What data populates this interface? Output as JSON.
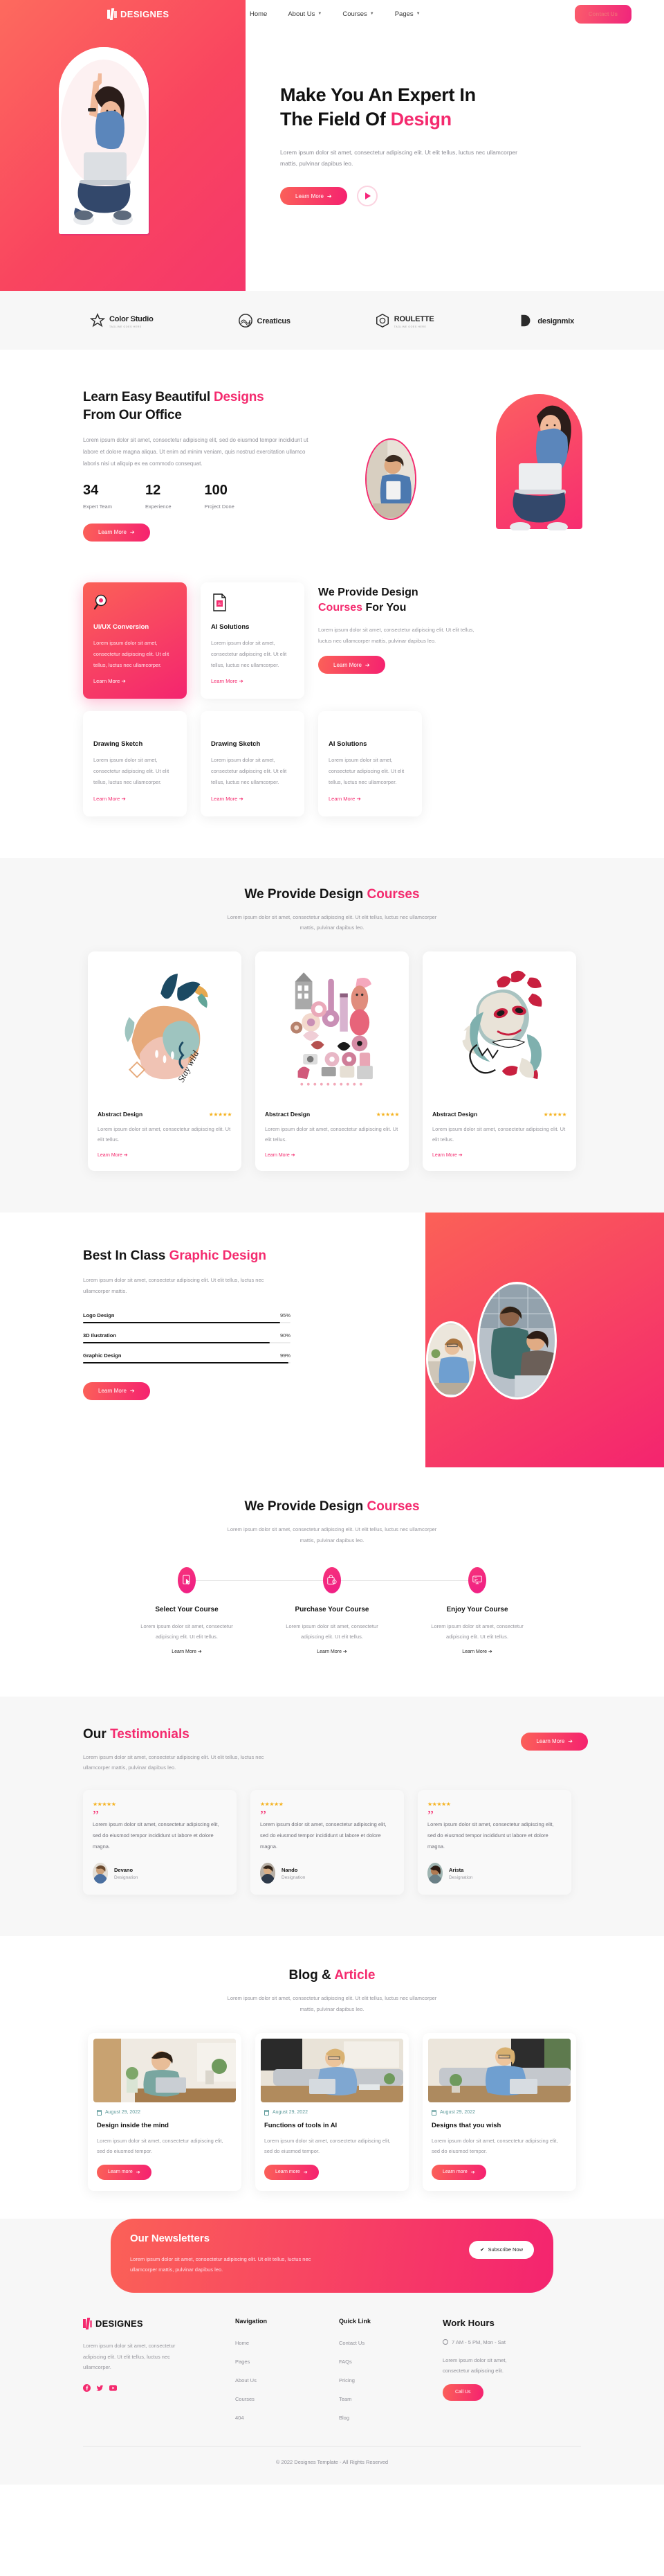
{
  "brand": {
    "name": "DESIGNES"
  },
  "nav": {
    "links": [
      {
        "label": "Home",
        "caret": false
      },
      {
        "label": "About Us",
        "caret": true
      },
      {
        "label": "Courses",
        "caret": true
      },
      {
        "label": "Pages",
        "caret": true
      }
    ],
    "cta": "Contact Us"
  },
  "hero": {
    "title_line1": "Make You An Expert In",
    "title_line2_plain": "The Field Of ",
    "title_line2_hl": "Design",
    "subtitle": "Lorem ipsum dolor sit amet, consectetur adipiscing elit. Ut elit tellus, luctus nec ullamcorper mattis, pulvinar dapibus leo.",
    "cta": "Learn More",
    "play": "play-button"
  },
  "partners": [
    {
      "name": "Color Studio",
      "tagline": "TAGLINE GOES HERE",
      "icon": "star-icon"
    },
    {
      "name": "Creaticus",
      "tagline": "",
      "icon": "wave-circle-icon"
    },
    {
      "name": "ROULETTE",
      "tagline": "TAGLINE GOES HERE",
      "icon": "hexagon-icon"
    },
    {
      "name": "designmix",
      "tagline": "",
      "icon": "d-mark-icon"
    }
  ],
  "about": {
    "title_l1_plain": "Learn Easy Beautiful ",
    "title_l1_hl": "Designs",
    "title_l2": "From Our Office",
    "paragraph": "Lorem ipsum dolor sit amet, consectetur adipiscing elit, sed do eiusmod tempor incididunt ut labore et dolore magna aliqua. Ut enim ad minim veniam, quis nostrud exercitation ullamco laboris nisi ut aliquip ex ea commodo consequat.",
    "stats": [
      {
        "value": "34",
        "label": "Expert Team"
      },
      {
        "value": "12",
        "label": "Experience"
      },
      {
        "value": "100",
        "label": "Project Done"
      }
    ],
    "cta": "Learn More"
  },
  "features": {
    "cards": [
      {
        "title": "UI/UX Conversion",
        "text": "Lorem ipsum dolor sit amet, consectetur adipiscing elit. Ut elit tellus, luctus nec ullamcorper.",
        "link": "Learn More",
        "icon": "magnifier-icon",
        "active": true
      },
      {
        "title": "AI Solutions",
        "text": "Lorem ipsum dolor sit amet, consectetur adipiscing elit. Ut elit tellus, luctus nec ullamcorper.",
        "link": "Learn More",
        "icon": "ai-file-icon",
        "active": false
      }
    ],
    "side": {
      "title_l1": "We Provide Design",
      "title_l2_hl": "Courses",
      "title_l2_plain": " For You",
      "text": "Lorem ipsum dolor sit amet, consectetur adipiscing elit. Ut elit tellus, luctus nec ullamcorper mattis, pulvinar dapibus leo.",
      "cta": "Learn More"
    },
    "row2": [
      {
        "title": "Drawing Sketch",
        "text": "Lorem ipsum dolor sit amet, consectetur adipiscing elit. Ut elit tellus, luctus nec ullamcorper.",
        "link": "Learn More"
      },
      {
        "title": "Drawing Sketch",
        "text": "Lorem ipsum dolor sit amet, consectetur adipiscing elit. Ut elit tellus, luctus nec ullamcorper.",
        "link": "Learn More"
      },
      {
        "title": "AI Solutions",
        "text": "Lorem ipsum dolor sit amet, consectetur adipiscing elit. Ut elit tellus, luctus nec ullamcorper.",
        "link": "Learn More"
      }
    ]
  },
  "courses": {
    "title_plain": "We Provide Design ",
    "title_hl": "Courses",
    "subtitle": "Lorem ipsum dolor sit amet, consectetur adipiscing elit. Ut elit tellus, luctus nec ullamcorper mattis, pulvinar dapibus leo.",
    "cards": [
      {
        "title": "Abstract Design",
        "stars": "★★★★★",
        "text": "Lorem ipsum dolor sit amet, consectetur adipiscing elit. Ut elit tellus.",
        "link": "Learn More",
        "art": "stay-wild-illustration"
      },
      {
        "title": "Abstract Design",
        "stars": "★★★★★",
        "text": "Lorem ipsum dolor sit amet, consectetur adipiscing elit. Ut elit tellus.",
        "link": "Learn More",
        "art": "collage-illustration"
      },
      {
        "title": "Abstract Design",
        "stars": "★★★★★",
        "text": "Lorem ipsum dolor sit amet, consectetur adipiscing elit. Ut elit tellus.",
        "link": "Learn More",
        "art": "mask-illustration"
      }
    ]
  },
  "skills": {
    "title_plain": "Best In Class ",
    "title_hl": "Graphic Design",
    "text": "Lorem ipsum dolor sit amet, consectetur adipiscing elit. Ut elit tellus, luctus nec ullamcorper mattis.",
    "cta": "Learn More"
  },
  "steps": {
    "title_plain": "We Provide Design ",
    "title_hl": "Courses",
    "subtitle": "Lorem ipsum dolor sit amet, consectetur adipiscing elit. Ut elit tellus, luctus nec ullamcorper mattis, pulvinar dapibus leo.",
    "items": [
      {
        "title": "Select Your Course",
        "text": "Lorem ipsum dolor sit amet, consectetur adipiscing elit. Ut elit tellus.",
        "link": "Learn More",
        "icon": "cursor-select-icon"
      },
      {
        "title": "Purchase Your Course",
        "text": "Lorem ipsum dolor sit amet, consectetur adipiscing elit. Ut elit tellus.",
        "link": "Learn More",
        "icon": "purchase-card-icon"
      },
      {
        "title": "Enjoy Your Course",
        "text": "Lorem ipsum dolor sit amet, consectetur adipiscing elit. Ut elit tellus.",
        "link": "Learn More",
        "icon": "monitor-learn-icon"
      }
    ]
  },
  "testimonials": {
    "title_plain": "Our ",
    "title_hl": "Testimonials",
    "text": "Lorem ipsum dolor sit amet, consectetur adipiscing elit. Ut elit tellus, luctus nec ullamcorper mattis, pulvinar dapibus leo.",
    "cta": "Learn More",
    "items": [
      {
        "stars": "★★★★★",
        "quote": "Lorem ipsum dolor sit amet, consectetur adipiscing elit, sed do eiusmod tempor incididunt ut labore et dolore magna.",
        "name": "Devano",
        "designation": "Designation"
      },
      {
        "stars": "★★★★★",
        "quote": "Lorem ipsum dolor sit amet, consectetur adipiscing elit, sed do eiusmod tempor incididunt ut labore et dolore magna.",
        "name": "Nando",
        "designation": "Designation"
      },
      {
        "stars": "★★★★★",
        "quote": "Lorem ipsum dolor sit amet, consectetur adipiscing elit, sed do eiusmod tempor incididunt ut labore et dolore magna.",
        "name": "Arista",
        "designation": "Designation"
      }
    ]
  },
  "blog": {
    "title_plain": "Blog & ",
    "title_hl": "Article",
    "subtitle": "Lorem ipsum dolor sit amet, consectetur adipiscing elit. Ut elit tellus, luctus nec ullamcorper mattis, pulvinar dapibus leo.",
    "posts": [
      {
        "date": "August 29, 2022",
        "title": "Design inside the mind",
        "text": "Lorem ipsum dolor sit amet, consectetur adipiscing elit, sed do eiusmod tempor.",
        "cta": "Learn more"
      },
      {
        "date": "August 29, 2022",
        "title": "Functions of tools in AI",
        "text": "Lorem ipsum dolor sit amet, consectetur adipiscing elit, sed do eiusmod tempor.",
        "cta": "Learn more"
      },
      {
        "date": "August 29, 2022",
        "title": "Designs that you wish",
        "text": "Lorem ipsum dolor sit amet, consectetur adipiscing elit, sed do eiusmod tempor.",
        "cta": "Learn more"
      }
    ]
  },
  "newsletter": {
    "title": "Our Newsletters",
    "text": "Lorem ipsum dolor sit amet, consectetur adipiscing elit. Ut elit tellus, luctus nec ullamcorper mattis, pulvinar dapibus leo.",
    "cta": "Subscribe Now"
  },
  "footer": {
    "about": "Lorem ipsum dolor sit amet, consectetur adipiscing elit. Ut elit tellus, luctus nec ullamcorper.",
    "socials": [
      "facebook-icon",
      "twitter-icon",
      "youtube-icon"
    ],
    "navigation": {
      "heading": "Navigation",
      "items": [
        "Home",
        "Pages",
        "About Us",
        "Courses",
        "404"
      ]
    },
    "quicklink": {
      "heading": "Quick Link",
      "items": [
        "Contact Us",
        "FAQs",
        "Pricing",
        "Team",
        "Blog"
      ]
    },
    "workhours": {
      "heading": "Work Hours",
      "hours": "7 AM - 5 PM, Mon - Sat",
      "text": "Lorem ipsum dolor sit amet, consectetur adipiscing elit.",
      "cta": "Call Us"
    },
    "copyright": "© 2022 Designes Template - All Rights Reserved"
  },
  "colors": {
    "accent": "#f42a6e",
    "gradient_start": "#fb6157",
    "gradient_end": "#f4246f",
    "star": "#f5b21f"
  },
  "chart_data": {
    "type": "bar",
    "title": "Best In Class Graphic Design",
    "categories": [
      "Logo Design",
      "3D Ilustration",
      "Graphic Design"
    ],
    "values": [
      95,
      90,
      99
    ],
    "labels": [
      "95%",
      "90%",
      "99%"
    ],
    "xlabel": "",
    "ylabel": "",
    "ylim": [
      0,
      100
    ],
    "orientation": "horizontal",
    "grid": false,
    "legend": "none"
  }
}
